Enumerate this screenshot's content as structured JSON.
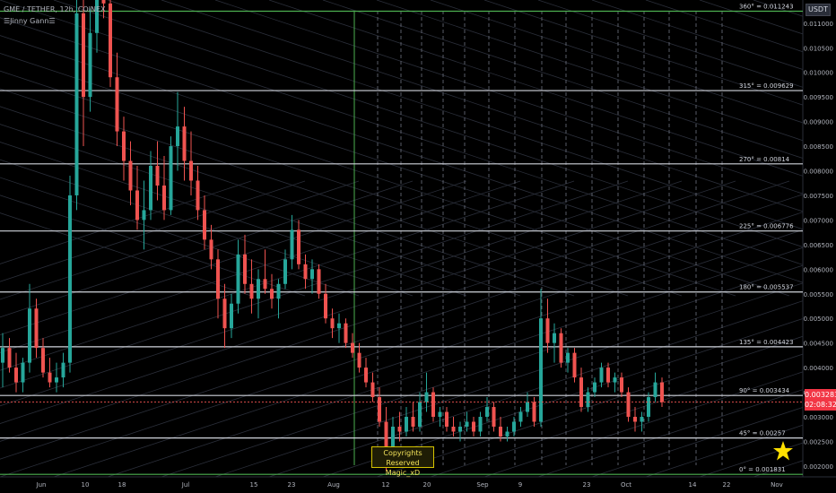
{
  "header": {
    "title": "GME / TETHER, 12h, COINEX",
    "indicator": "☰Jinny Gann☰",
    "currency": "USDT"
  },
  "badge": {
    "price": "0.003283",
    "countdown": "02:08:32"
  },
  "watermark": {
    "line1": "Copyrights Reserved",
    "line2": "Magic_xD"
  },
  "chart_data": {
    "type": "candlestick",
    "price_axis_ticks": [
      "0.011000",
      "0.010500",
      "0.010000",
      "0.009500",
      "0.009000",
      "0.008500",
      "0.008000",
      "0.007500",
      "0.007000",
      "0.006500",
      "0.006000",
      "0.005500",
      "0.005000",
      "0.004500",
      "0.004000",
      "0.003500",
      "0.003000",
      "0.002500",
      "0.002000"
    ],
    "time_axis_ticks": [
      "Jun",
      "10",
      "18",
      "Jul",
      "15",
      "23",
      "Aug",
      "12",
      "20",
      "Sep",
      "9",
      "23",
      "Oct",
      "14",
      "22",
      "Nov"
    ],
    "ylim": [
      0.00178,
      0.01147
    ],
    "gann_levels": [
      {
        "label": "360° = 0.011243",
        "value": 0.011243,
        "color": "#4caf50"
      },
      {
        "label": "315° = 0.009629",
        "value": 0.009629,
        "color": "#d1d4dc"
      },
      {
        "label": "270° = 0.00814",
        "value": 0.00814,
        "color": "#d1d4dc"
      },
      {
        "label": "225° = 0.006776",
        "value": 0.006776,
        "color": "#d1d4dc"
      },
      {
        "label": "180° = 0.005537",
        "value": 0.005537,
        "color": "#d1d4dc"
      },
      {
        "label": "135° = 0.004423",
        "value": 0.004423,
        "color": "#d1d4dc"
      },
      {
        "label": "90° = 0.003434",
        "value": 0.003434,
        "color": "#d1d4dc"
      },
      {
        "label": "45° = 0.00257",
        "value": 0.00257,
        "color": "#d1d4dc"
      },
      {
        "label": "0° = 0.001831",
        "value": 0.001831,
        "color": "#4caf50"
      }
    ],
    "candles": [
      [
        0.0041,
        0.0047,
        0.0036,
        0.0044
      ],
      [
        0.0044,
        0.0046,
        0.0039,
        0.004
      ],
      [
        0.004,
        0.0043,
        0.0035,
        0.0037
      ],
      [
        0.0037,
        0.0042,
        0.0035,
        0.0041
      ],
      [
        0.0041,
        0.0057,
        0.0039,
        0.0052
      ],
      [
        0.0052,
        0.0054,
        0.0042,
        0.0044
      ],
      [
        0.0044,
        0.0046,
        0.0038,
        0.0039
      ],
      [
        0.0039,
        0.0042,
        0.0036,
        0.0037
      ],
      [
        0.0037,
        0.0041,
        0.0035,
        0.0038
      ],
      [
        0.0038,
        0.0043,
        0.0036,
        0.0041
      ],
      [
        0.0041,
        0.0079,
        0.0039,
        0.0075
      ],
      [
        0.0075,
        0.0121,
        0.0072,
        0.0112
      ],
      [
        0.0112,
        0.0118,
        0.0085,
        0.0095
      ],
      [
        0.0095,
        0.0113,
        0.0092,
        0.0108
      ],
      [
        0.0108,
        0.0121,
        0.0104,
        0.0116
      ],
      [
        0.0116,
        0.0121,
        0.0111,
        0.0114
      ],
      [
        0.0114,
        0.0121,
        0.0097,
        0.0099
      ],
      [
        0.0099,
        0.0104,
        0.0085,
        0.0088
      ],
      [
        0.0088,
        0.0091,
        0.0078,
        0.0082
      ],
      [
        0.0082,
        0.0086,
        0.0073,
        0.0076
      ],
      [
        0.0076,
        0.0081,
        0.0068,
        0.007
      ],
      [
        0.007,
        0.0078,
        0.0064,
        0.0072
      ],
      [
        0.0072,
        0.0084,
        0.007,
        0.0081
      ],
      [
        0.0081,
        0.0086,
        0.0074,
        0.0077
      ],
      [
        0.0077,
        0.0083,
        0.007,
        0.0072
      ],
      [
        0.0072,
        0.0087,
        0.0071,
        0.0085
      ],
      [
        0.0085,
        0.0096,
        0.008,
        0.0089
      ],
      [
        0.0089,
        0.0093,
        0.0078,
        0.0082
      ],
      [
        0.0082,
        0.0088,
        0.0075,
        0.0078
      ],
      [
        0.0078,
        0.0081,
        0.007,
        0.0072
      ],
      [
        0.0072,
        0.0075,
        0.0064,
        0.0066
      ],
      [
        0.0066,
        0.0069,
        0.006,
        0.0062
      ],
      [
        0.0062,
        0.0064,
        0.005,
        0.0054
      ],
      [
        0.0054,
        0.0057,
        0.0044,
        0.0048
      ],
      [
        0.0048,
        0.0055,
        0.0046,
        0.0053
      ],
      [
        0.0053,
        0.0066,
        0.0051,
        0.0063
      ],
      [
        0.0063,
        0.0067,
        0.0055,
        0.0057
      ],
      [
        0.0057,
        0.0062,
        0.0051,
        0.0054
      ],
      [
        0.0054,
        0.006,
        0.005,
        0.0058
      ],
      [
        0.0058,
        0.0064,
        0.0055,
        0.0056
      ],
      [
        0.0056,
        0.0059,
        0.0052,
        0.0054
      ],
      [
        0.0054,
        0.0058,
        0.005,
        0.0057
      ],
      [
        0.0057,
        0.0064,
        0.0056,
        0.0062
      ],
      [
        0.0062,
        0.0071,
        0.006,
        0.0068
      ],
      [
        0.0068,
        0.007,
        0.006,
        0.0061
      ],
      [
        0.0061,
        0.0063,
        0.0056,
        0.0058
      ],
      [
        0.0058,
        0.0062,
        0.0055,
        0.006
      ],
      [
        0.006,
        0.0061,
        0.0054,
        0.0055
      ],
      [
        0.0055,
        0.0057,
        0.0049,
        0.005
      ],
      [
        0.005,
        0.0052,
        0.0046,
        0.0048
      ],
      [
        0.0048,
        0.0051,
        0.0045,
        0.0049
      ],
      [
        0.0049,
        0.005,
        0.0044,
        0.0045
      ],
      [
        0.0045,
        0.0047,
        0.0042,
        0.0043
      ],
      [
        0.0043,
        0.0045,
        0.0039,
        0.004
      ],
      [
        0.004,
        0.0042,
        0.0036,
        0.0037
      ],
      [
        0.0037,
        0.0039,
        0.0033,
        0.0034
      ],
      [
        0.0034,
        0.0036,
        0.0028,
        0.0029
      ],
      [
        0.0029,
        0.0032,
        0.0019,
        0.0024
      ],
      [
        0.0024,
        0.003,
        0.0021,
        0.0028
      ],
      [
        0.0028,
        0.0031,
        0.0025,
        0.0027
      ],
      [
        0.0027,
        0.0032,
        0.0026,
        0.003
      ],
      [
        0.003,
        0.0033,
        0.0027,
        0.0028
      ],
      [
        0.0028,
        0.0035,
        0.0027,
        0.0033
      ],
      [
        0.0033,
        0.0039,
        0.0031,
        0.0035
      ],
      [
        0.0035,
        0.0036,
        0.0029,
        0.003
      ],
      [
        0.003,
        0.0032,
        0.0028,
        0.0031
      ],
      [
        0.0031,
        0.0032,
        0.0027,
        0.0028
      ],
      [
        0.0028,
        0.003,
        0.0026,
        0.0027
      ],
      [
        0.0027,
        0.0029,
        0.0025,
        0.0028
      ],
      [
        0.0028,
        0.0031,
        0.0027,
        0.0029
      ],
      [
        0.0029,
        0.003,
        0.0026,
        0.0027
      ],
      [
        0.0027,
        0.0031,
        0.0026,
        0.003
      ],
      [
        0.003,
        0.0034,
        0.0029,
        0.0032
      ],
      [
        0.0032,
        0.0033,
        0.0027,
        0.0028
      ],
      [
        0.0028,
        0.003,
        0.0025,
        0.0026
      ],
      [
        0.0026,
        0.0028,
        0.0025,
        0.0027
      ],
      [
        0.0027,
        0.003,
        0.0026,
        0.0029
      ],
      [
        0.0029,
        0.0032,
        0.0028,
        0.0031
      ],
      [
        0.0031,
        0.0035,
        0.003,
        0.0033
      ],
      [
        0.0033,
        0.0034,
        0.0028,
        0.0029
      ],
      [
        0.0029,
        0.0056,
        0.0028,
        0.005
      ],
      [
        0.005,
        0.0054,
        0.0043,
        0.0045
      ],
      [
        0.0045,
        0.0049,
        0.0041,
        0.0047
      ],
      [
        0.0047,
        0.0048,
        0.004,
        0.0041
      ],
      [
        0.0041,
        0.0044,
        0.0039,
        0.0043
      ],
      [
        0.0043,
        0.0044,
        0.0037,
        0.0038
      ],
      [
        0.0038,
        0.004,
        0.0031,
        0.0032
      ],
      [
        0.0032,
        0.0036,
        0.0031,
        0.0035
      ],
      [
        0.0035,
        0.0038,
        0.0034,
        0.0037
      ],
      [
        0.0037,
        0.0041,
        0.0036,
        0.004
      ],
      [
        0.004,
        0.0041,
        0.0036,
        0.0037
      ],
      [
        0.0037,
        0.0039,
        0.0035,
        0.0038
      ],
      [
        0.0038,
        0.0039,
        0.0034,
        0.0035
      ],
      [
        0.0035,
        0.0036,
        0.0029,
        0.003
      ],
      [
        0.003,
        0.0032,
        0.0027,
        0.0029
      ],
      [
        0.0029,
        0.0031,
        0.0027,
        0.003
      ],
      [
        0.003,
        0.0035,
        0.0029,
        0.0034
      ],
      [
        0.0034,
        0.0039,
        0.0033,
        0.0037
      ],
      [
        0.0037,
        0.0038,
        0.0032,
        0.0033
      ]
    ]
  }
}
